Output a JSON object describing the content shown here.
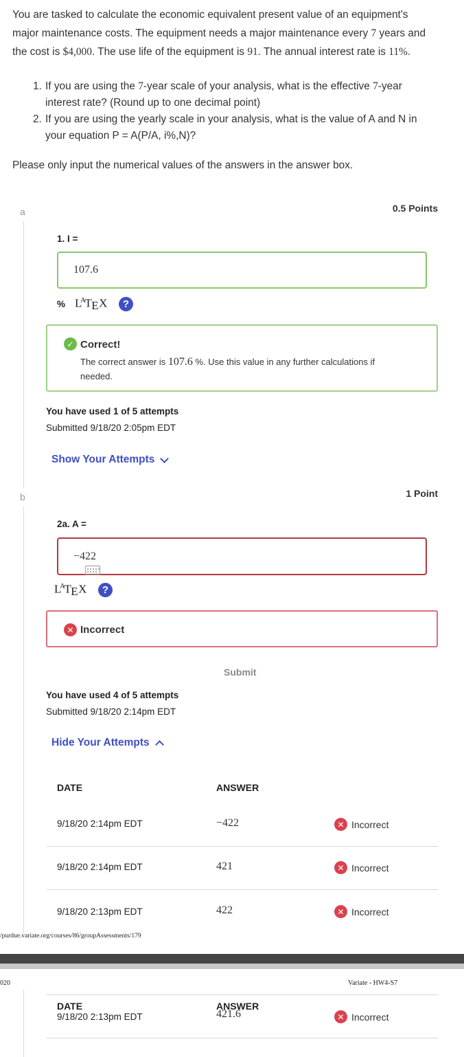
{
  "intro": {
    "line1": "You are tasked to calculate the economic equivalent present value of an equipment's",
    "line2_prefix": "major maintenance costs. The equipment needs a major maintenance every ",
    "line2_num": "7",
    "line2_suffix": " years and",
    "line3_prefix": "the cost is ",
    "line3_cost": "$4,000",
    "line3_mid": ". The use life of the equipment is ",
    "line3_life": "91",
    "line3_mid2": ". The annual interest rate is ",
    "line3_rate": "11%",
    "line3_end": "."
  },
  "questions": [
    {
      "num": "1.",
      "text_a": "If you are using the ",
      "math_a": "7",
      "text_b": "-year scale of your analysis, what is the effective ",
      "math_b": "7",
      "text_c": "-year",
      "line2": "interest rate? (Round up to one decimal point)"
    },
    {
      "num": "2.",
      "line1": "If  you are using the yearly scale in your analysis, what is the value of A and N in",
      "line2": "your equation P = A(P/A, i%,N)?"
    }
  ],
  "note": "Please only input the numerical values of the answers in the answer box.",
  "part_a": {
    "letter": "a",
    "points": "0.5 Points",
    "label": "1. I =",
    "answer": "107.6",
    "unit": "%",
    "latex": "LATEX",
    "help": "?",
    "feedback_title": "Correct!",
    "feedback_pre": "The correct answer is ",
    "feedback_value": "107.6",
    "feedback_post": " %. Use this value in any further calculations if",
    "feedback_line2": "needed.",
    "attempts_used": "You have used 1 of 5 attempts",
    "submitted": "Submitted 9/18/20 2:05pm EDT",
    "toggle": "Show Your Attempts"
  },
  "part_b": {
    "letter": "b",
    "points": "1 Point",
    "label": "2a. A =",
    "answer": "−422",
    "latex": "LATEX",
    "help": "?",
    "feedback_title": "Incorrect",
    "submit": "Submit",
    "attempts_used": "You have used 4 of 5 attempts",
    "submitted": "Submitted 9/18/20 2:14pm EDT",
    "toggle": "Hide Your Attempts",
    "table": {
      "col_date": "DATE",
      "col_answer": "ANSWER",
      "rows": [
        {
          "date": "9/18/20 2:14pm EDT",
          "answer": "−422",
          "status": "Incorrect"
        },
        {
          "date": "9/18/20 2:14pm EDT",
          "answer": "421",
          "status": "Incorrect"
        },
        {
          "date": "9/18/20 2:13pm EDT",
          "answer": "422",
          "status": "Incorrect"
        }
      ],
      "continued_row": {
        "date": "9/18/20 2:13pm EDT",
        "answer": "421.6",
        "status": "Incorrect"
      }
    }
  },
  "print": {
    "footer_url": "/purdue.variate.org/courses/86/groupAssessments/179",
    "header_left": "020",
    "header_right": "Variate - HW4-S7"
  },
  "colors": {
    "link": "#3f4fc2",
    "correct_border": "#8ac66b",
    "incorrect_border": "#b0383f",
    "incorrect_icon": "#d9434e",
    "correct_icon": "#6dbb4a"
  }
}
